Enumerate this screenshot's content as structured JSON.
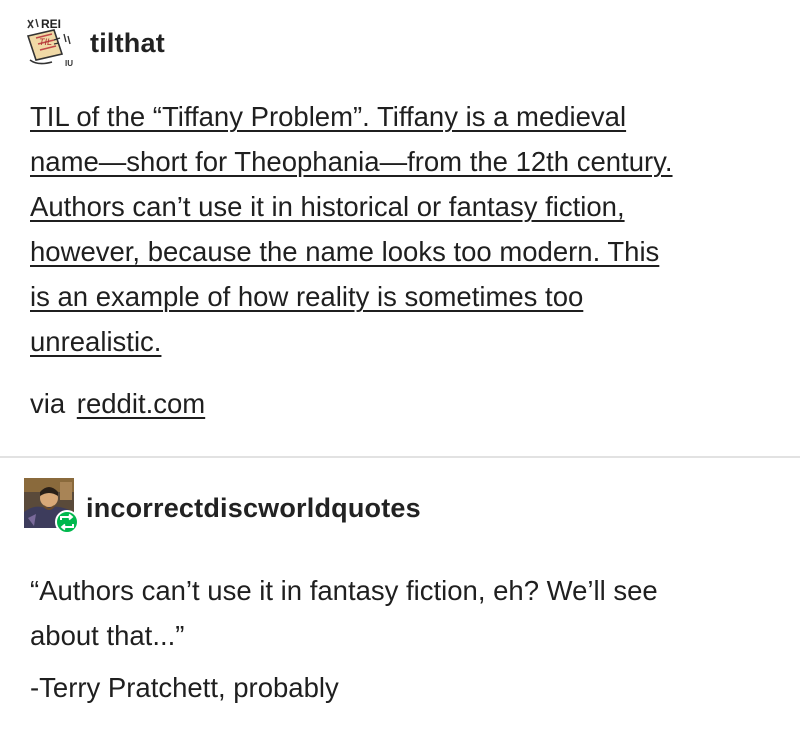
{
  "post1": {
    "username": "tilthat",
    "avatar_icon": "reddit-til-logo-icon",
    "avatar_text": "REI",
    "paragraph": [
      "TIL of the “Tiffany Problem”. Tiffany is a medieval",
      "name—short for Theophania—from the 12th century.",
      "Authors can’t use it in historical or fantasy fiction,",
      "however, because the name looks too modern. This",
      "is an example of how reality is sometimes too",
      "unrealistic."
    ],
    "via_label": "via",
    "via_link": "reddit.com"
  },
  "post2": {
    "username": "incorrectdiscworldquotes",
    "avatar_icon": "illustrated-portrait-avatar",
    "reblog_icon": "reblog-icon",
    "reblog_color": "#00b84d",
    "quote_lines": [
      "“Authors can’t use it in fantasy fiction, eh? We’ll see",
      "about that...”"
    ],
    "signature": "-Terry Pratchett, probably"
  }
}
